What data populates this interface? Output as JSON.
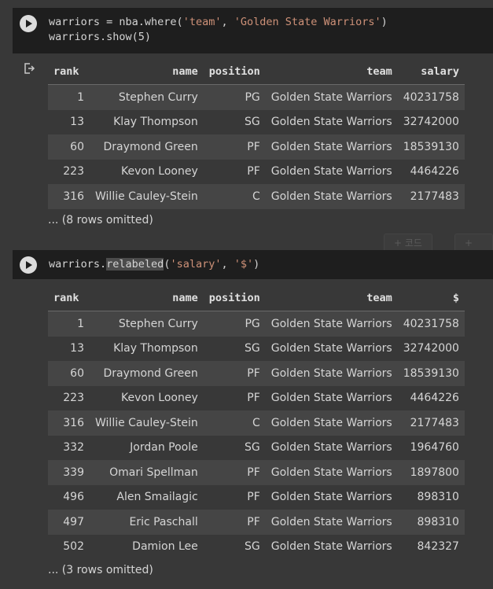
{
  "cell1": {
    "code_line1_prefix": "warriors = nba.where(",
    "code_line1_arg1": "'team'",
    "code_line1_sep": ", ",
    "code_line1_arg2": "'Golden State Warriors'",
    "code_line1_suffix": ")",
    "code_line2": "warriors.show(5)",
    "columns": [
      "rank",
      "name",
      "position",
      "team",
      "salary"
    ],
    "rows": [
      [
        "1",
        "Stephen Curry",
        "PG",
        "Golden State Warriors",
        "40231758"
      ],
      [
        "13",
        "Klay Thompson",
        "SG",
        "Golden State Warriors",
        "32742000"
      ],
      [
        "60",
        "Draymond Green",
        "PF",
        "Golden State Warriors",
        "18539130"
      ],
      [
        "223",
        "Kevon Looney",
        "PF",
        "Golden State Warriors",
        "4464226"
      ],
      [
        "316",
        "Willie Cauley-Stein",
        "C",
        "Golden State Warriors",
        "2177483"
      ]
    ],
    "omitted": "... (8 rows omitted)"
  },
  "toolbar": {
    "add_code": "+ 코드",
    "add_text": "+ 텍스"
  },
  "cell2": {
    "code_prefix": "warriors.",
    "code_method": "relabeled",
    "code_open": "(",
    "code_arg1": "'salary'",
    "code_sep": ", ",
    "code_arg2": "'$'",
    "code_close": ")",
    "columns": [
      "rank",
      "name",
      "position",
      "team",
      "$"
    ],
    "rows": [
      [
        "1",
        "Stephen Curry",
        "PG",
        "Golden State Warriors",
        "40231758"
      ],
      [
        "13",
        "Klay Thompson",
        "SG",
        "Golden State Warriors",
        "32742000"
      ],
      [
        "60",
        "Draymond Green",
        "PF",
        "Golden State Warriors",
        "18539130"
      ],
      [
        "223",
        "Kevon Looney",
        "PF",
        "Golden State Warriors",
        "4464226"
      ],
      [
        "316",
        "Willie Cauley-Stein",
        "C",
        "Golden State Warriors",
        "2177483"
      ],
      [
        "332",
        "Jordan Poole",
        "SG",
        "Golden State Warriors",
        "1964760"
      ],
      [
        "339",
        "Omari Spellman",
        "PF",
        "Golden State Warriors",
        "1897800"
      ],
      [
        "496",
        "Alen Smailagic",
        "PF",
        "Golden State Warriors",
        "898310"
      ],
      [
        "497",
        "Eric Paschall",
        "PF",
        "Golden State Warriors",
        "898310"
      ],
      [
        "502",
        "Damion Lee",
        "SG",
        "Golden State Warriors",
        "842327"
      ]
    ],
    "omitted": "... (3 rows omitted)"
  }
}
